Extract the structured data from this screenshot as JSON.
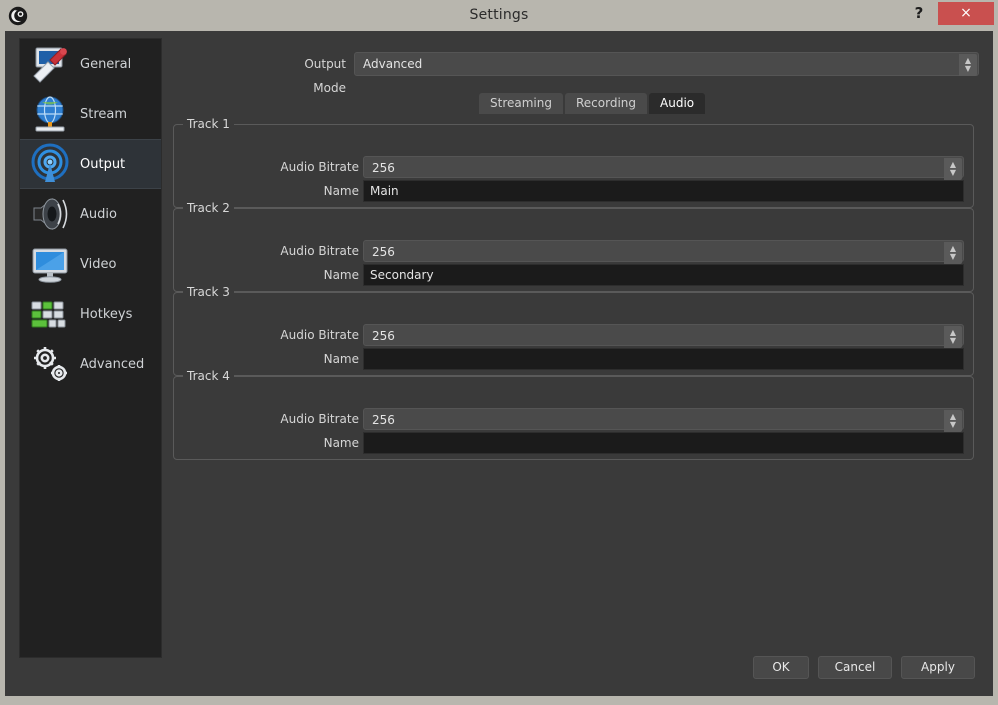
{
  "window": {
    "title": "Settings",
    "help_label": "?",
    "close_label": "×",
    "logo_icon": "obs-logo-icon",
    "titlebar_color": "#b8b6ae",
    "close_color": "#c9504f",
    "content_bg": "#3a3a3a",
    "sidebar_bg": "#212121"
  },
  "sidebar": {
    "items": [
      {
        "label": "General",
        "icon": "general-icon",
        "selected": false
      },
      {
        "label": "Stream",
        "icon": "stream-icon",
        "selected": false
      },
      {
        "label": "Output",
        "icon": "output-icon",
        "selected": true
      },
      {
        "label": "Audio",
        "icon": "audio-icon",
        "selected": false
      },
      {
        "label": "Video",
        "icon": "video-icon",
        "selected": false
      },
      {
        "label": "Hotkeys",
        "icon": "hotkeys-icon",
        "selected": false
      },
      {
        "label": "Advanced",
        "icon": "advanced-icon",
        "selected": false
      }
    ]
  },
  "output_mode": {
    "label": "Output Mode",
    "value": "Advanced",
    "spinner_up": "▲",
    "spinner_down": "▼"
  },
  "tabs": [
    {
      "label": "Streaming",
      "active": false
    },
    {
      "label": "Recording",
      "active": false
    },
    {
      "label": "Audio",
      "active": true
    }
  ],
  "tracks": [
    {
      "title": "Track 1",
      "bitrate_label": "Audio Bitrate",
      "bitrate_value": "256",
      "name_label": "Name",
      "name_value": "Main"
    },
    {
      "title": "Track 2",
      "bitrate_label": "Audio Bitrate",
      "bitrate_value": "256",
      "name_label": "Name",
      "name_value": "Secondary"
    },
    {
      "title": "Track 3",
      "bitrate_label": "Audio Bitrate",
      "bitrate_value": "256",
      "name_label": "Name",
      "name_value": ""
    },
    {
      "title": "Track 4",
      "bitrate_label": "Audio Bitrate",
      "bitrate_value": "256",
      "name_label": "Name",
      "name_value": ""
    }
  ],
  "buttons": {
    "ok": "OK",
    "cancel": "Cancel",
    "apply": "Apply"
  }
}
